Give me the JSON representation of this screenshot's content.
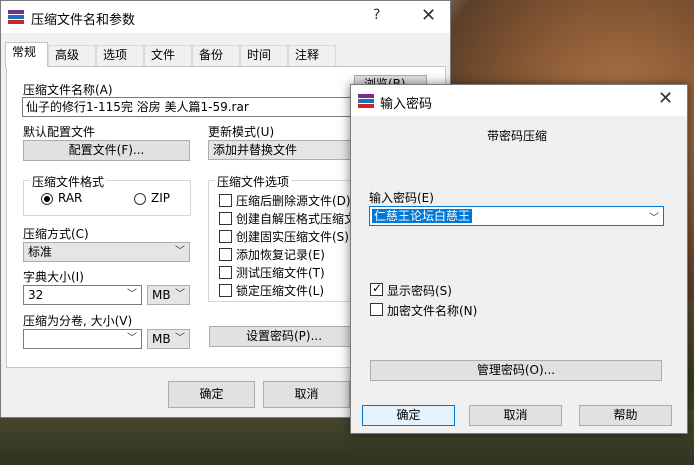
{
  "main_dialog": {
    "title": "压缩文件名和参数",
    "help": "?",
    "close": "✕",
    "tabs": [
      "常规",
      "高级",
      "选项",
      "文件",
      "备份",
      "时间",
      "注释"
    ],
    "archive_name_label": "压缩文件名称(A)",
    "archive_name_value": "仙子的修行1-115完  浴房 美人篇1-59.rar",
    "browse_button": "浏览(B)...",
    "default_profile_label": "默认配置文件",
    "profiles_button": "配置文件(F)...",
    "update_mode_label": "更新模式(U)",
    "update_mode_value": "添加并替换文件",
    "format_group": "压缩文件格式",
    "format_rar": "RAR",
    "format_zip": "ZIP",
    "method_label": "压缩方式(C)",
    "method_value": "标准",
    "dict_label": "字典大小(I)",
    "dict_value": "32",
    "dict_unit": "MB",
    "split_label": "压缩为分卷, 大小(V)",
    "split_value": "",
    "split_unit": "MB",
    "options_group": "压缩文件选项",
    "options": [
      "压缩后删除源文件(D)",
      "创建自解压格式压缩文",
      "创建固实压缩文件(S)",
      "添加恢复记录(E)",
      "测试压缩文件(T)",
      "锁定压缩文件(L)"
    ],
    "set_password_button": "设置密码(P)...",
    "ok_button": "确定",
    "cancel_button": "取消"
  },
  "password_dialog": {
    "title": "输入密码",
    "close": "✕",
    "heading": "带密码压缩",
    "enter_label": "输入密码(E)",
    "password_value": "仁慈王论坛白慈王",
    "show_password": "显示密码(S)",
    "show_password_checked": true,
    "encrypt_names": "加密文件名称(N)",
    "encrypt_names_checked": false,
    "manage_button": "管理密码(O)...",
    "ok_button": "确定",
    "cancel_button": "取消",
    "help_button": "帮助"
  }
}
